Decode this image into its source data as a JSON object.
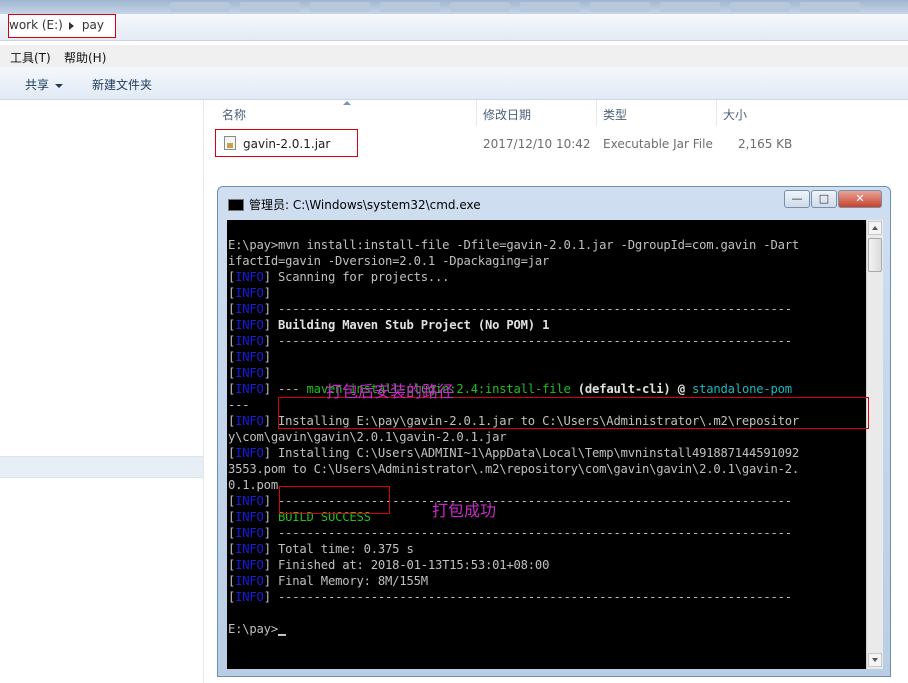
{
  "address_bar": {
    "segment1": "work (E:)",
    "segment2": "pay"
  },
  "menu": {
    "tools": "工具(T)",
    "help": "帮助(H)"
  },
  "toolbar": {
    "share": "共享",
    "new_folder": "新建文件夹"
  },
  "file_list": {
    "columns": {
      "name": "名称",
      "modified": "修改日期",
      "type": "类型",
      "size": "大小"
    },
    "rows": [
      {
        "name": "gavin-2.0.1.jar",
        "modified": "2017/12/10 10:42",
        "type": "Executable Jar File",
        "size": "2,165 KB"
      }
    ]
  },
  "cmd": {
    "title": "管理员: C:\\Windows\\system32\\cmd.exe",
    "buttons": {
      "min": "—",
      "max": "□",
      "close": "✕"
    },
    "tag": "INFO",
    "lines": {
      "l1": "E:\\pay>mvn install:install-file -Dfile=gavin-2.0.1.jar -DgroupId=com.gavin -Dart",
      "l2": "ifactId=gavin -Dversion=2.0.1 -Dpackaging=jar",
      "l3": "Scanning for projects...",
      "dash": "------------------------------------------------------------------------",
      "l5": "Building Maven Stub Project (No POM) 1",
      "l8a": "---",
      "l8plugin": "maven-install-plugin:2.4:install-file",
      "l8cli": "(default-cli)",
      "l8at": "@",
      "l8pom": "standalone-pom",
      "l9": "---",
      "l10": "Installing E:\\pay\\gavin-2.0.1.jar to C:\\Users\\Administrator\\.m2\\repositor",
      "l11": "y\\com\\gavin\\gavin\\2.0.1\\gavin-2.0.1.jar",
      "l12": "Installing C:\\Users\\ADMINI~1\\AppData\\Local\\Temp\\mvninstall491887144591092",
      "l13": "3553.pom to C:\\Users\\Administrator\\.m2\\repository\\com\\gavin\\gavin\\2.0.1\\gavin-2.",
      "l14": "0.1.pom",
      "build": "BUILD SUCCESS",
      "time": "Total time: 0.375 s",
      "finished": "Finished at: 2018-01-13T15:53:01+08:00",
      "memory": "Final Memory: 8M/155M",
      "prompt": "E:\\pay>"
    }
  },
  "annotations": {
    "path_note": "打包后安装的路径",
    "success_note": "打包成功"
  },
  "colors": {
    "highlight_box": "#d8000f",
    "annotation_text": "#c829c8",
    "info_tag": "#1a1ae0",
    "success_text": "#1ec01e"
  }
}
